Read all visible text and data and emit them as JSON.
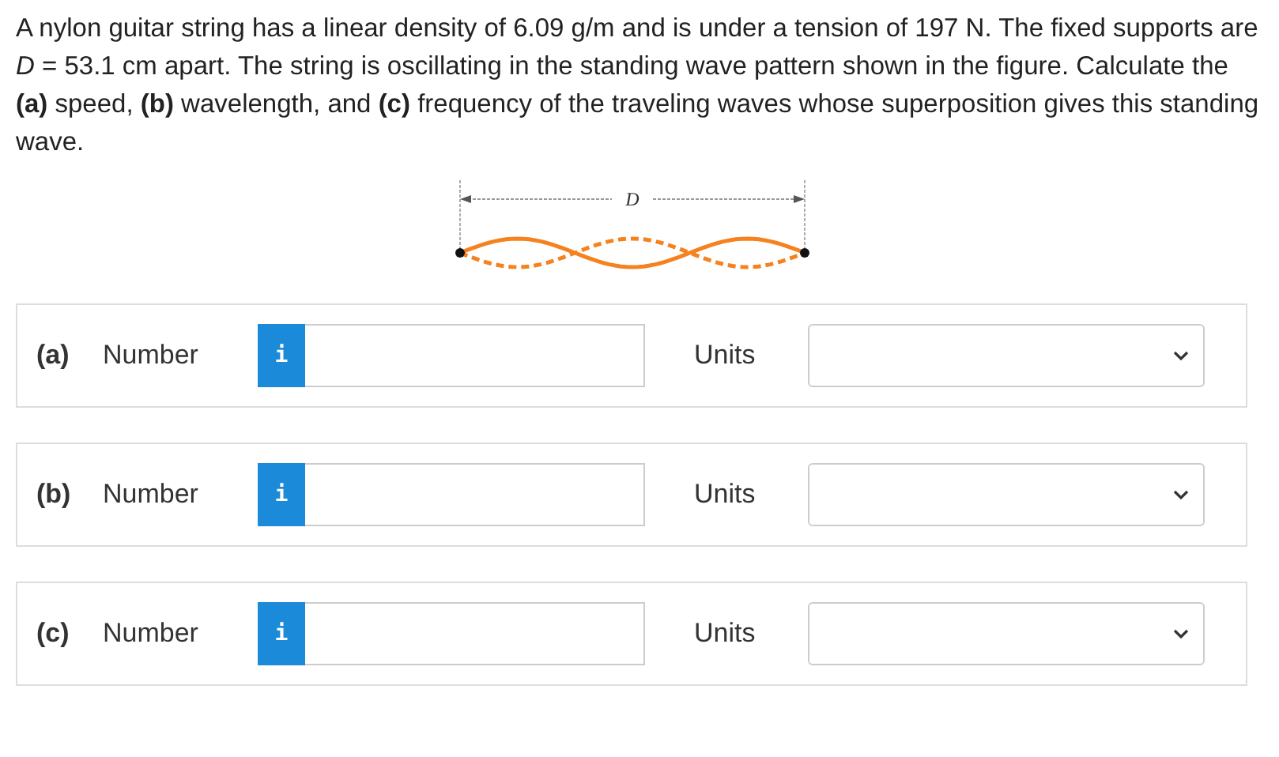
{
  "question": "A nylon guitar string has a linear density of 6.09 g/m and is under a tension of 197 N. The fixed supports are *D* = 53.1 cm apart. The string is oscillating in the standing wave pattern shown in the figure. Calculate the **(a)** speed, **(b)** wavelength, and **(c)** frequency of the traveling waves whose superposition gives this standing wave.",
  "figure": {
    "dimension_label": "D"
  },
  "answers": [
    {
      "part": "(a)",
      "label": "Number",
      "info": "i",
      "units_label": "Units"
    },
    {
      "part": "(b)",
      "label": "Number",
      "info": "i",
      "units_label": "Units"
    },
    {
      "part": "(c)",
      "label": "Number",
      "info": "i",
      "units_label": "Units"
    }
  ]
}
